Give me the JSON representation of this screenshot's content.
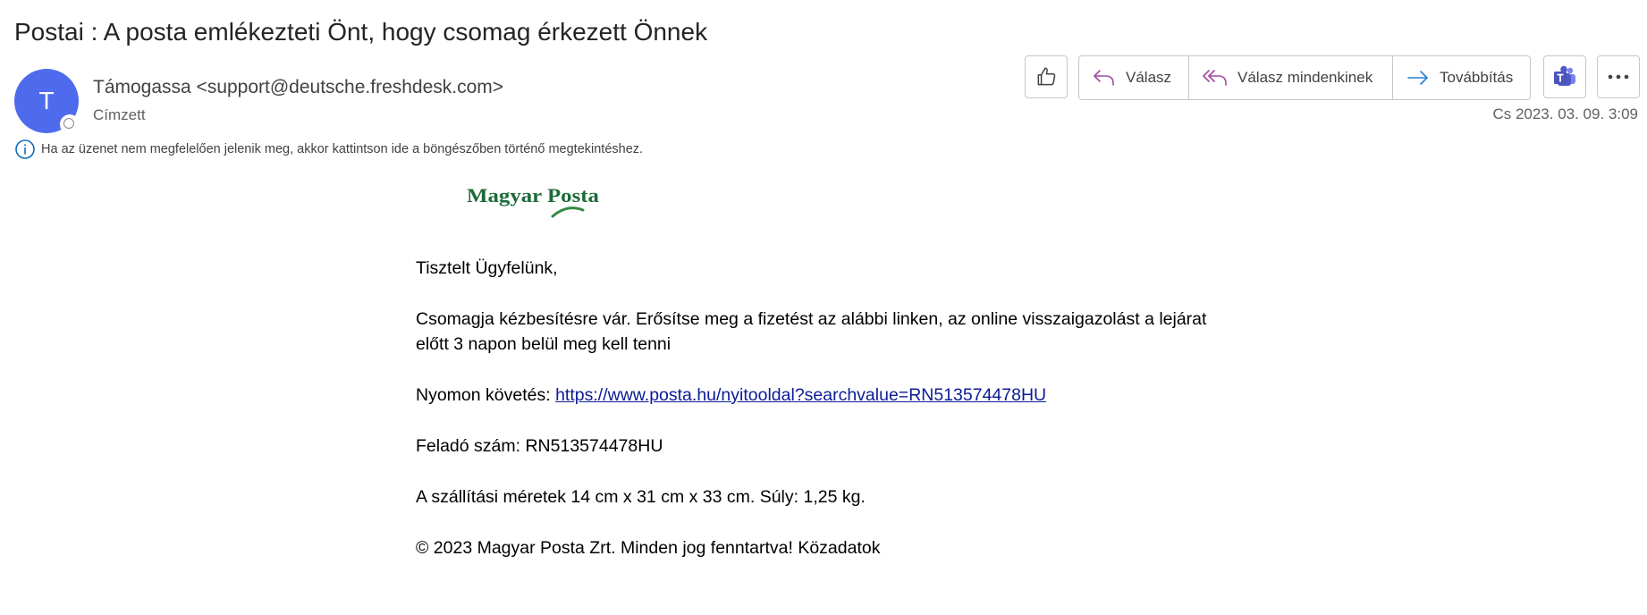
{
  "email": {
    "subject": "Postai : A posta emlékezteti Önt, hogy csomag érkezett Önnek",
    "avatar_initial": "T",
    "sender": "Támogassa <support@deutsche.freshdesk.com>",
    "recipient_label": "Címzett",
    "datetime": "Cs 2023. 03. 09.  3:09",
    "info_message": "Ha az üzenet nem megfelelően jelenik meg, akkor kattintson ide a böngészőben történő megtekintéshez."
  },
  "toolbar": {
    "like_icon": "thumbs-up-icon",
    "reply_label": "Válasz",
    "reply_all_label": "Válasz mindenkinek",
    "forward_label": "Továbbítás",
    "teams_icon": "teams-icon",
    "more_icon": "more-icon"
  },
  "colors": {
    "avatar": "#4f6bed",
    "reply_icon": "#a24a9e",
    "forward_icon": "#2b7cd3",
    "link": "#0b1b96",
    "logo_green": "#1f6b3a"
  },
  "message": {
    "logo_text": "Magyar Posta",
    "greeting": "Tisztelt Ügyfelünk,",
    "paragraph": "Csomagja kézbesítésre vár. Erősítse meg a fizetést az alábbi linken, az online visszaigazolást a lejárat előtt 3 napon belül meg kell tenni",
    "tracking_label": "Nyomon követés: ",
    "tracking_link": "https://www.posta.hu/nyitooldal?searchvalue=RN513574478HU",
    "sender_number": "Feladó szám: RN513574478HU",
    "dimensions": "A szállítási méretek 14 cm x 31 cm x 33 cm. Súly: 1,25 kg.",
    "footer": "© 2023 Magyar Posta Zrt. Minden jog fenntartva! Közadatok"
  }
}
